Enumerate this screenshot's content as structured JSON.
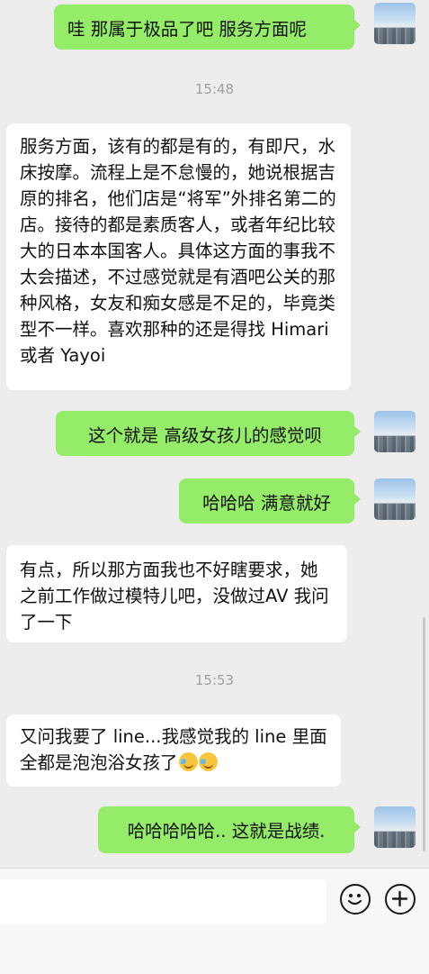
{
  "messages": [
    {
      "type": "out",
      "text": "哇 那属于极品了吧 服务方面呢"
    },
    {
      "type": "time",
      "text": "15:48"
    },
    {
      "type": "in",
      "text": "服务方面，该有的都是有的，有即尺，水床按摩。流程上是不怠慢的，她说根据吉原的排名，他们店是“将军”外排名第二的店。接待的都是素质客人，或者年纪比较大的日本本国客人。具体这方面的事我不太会描述，不过感觉就是有酒吧公关的那种风格，女友和痴女感是不足的，毕竟类型不一样。喜欢那种的还是得找 Himari或者 Yayoi"
    },
    {
      "type": "out",
      "text": "这个就是 高级女孩儿的感觉呗"
    },
    {
      "type": "out",
      "text": "哈哈哈 满意就好"
    },
    {
      "type": "in",
      "text": "有点，所以那方面我也不好瞎要求，她之前工作做过模特儿吧，没做过AV 我问了一下"
    },
    {
      "type": "time",
      "text": "15:53"
    },
    {
      "type": "in",
      "text": "又问我要了 line...我感觉我的 line 里面全都是泡泡浴女孩了"
    },
    {
      "type": "out",
      "text": "哈哈哈哈哈.. 这就是战绩."
    }
  ],
  "emojis": [
    "laugh-cry-emoji",
    "laugh-cry-emoji"
  ],
  "colors": {
    "background": "#ededed",
    "outgoing_bubble": "#95ec69",
    "incoming_bubble": "#ffffff",
    "timestamp": "#a0a0a0"
  },
  "input_bar": {
    "buttons": [
      "emoji-icon",
      "plus-icon"
    ]
  }
}
